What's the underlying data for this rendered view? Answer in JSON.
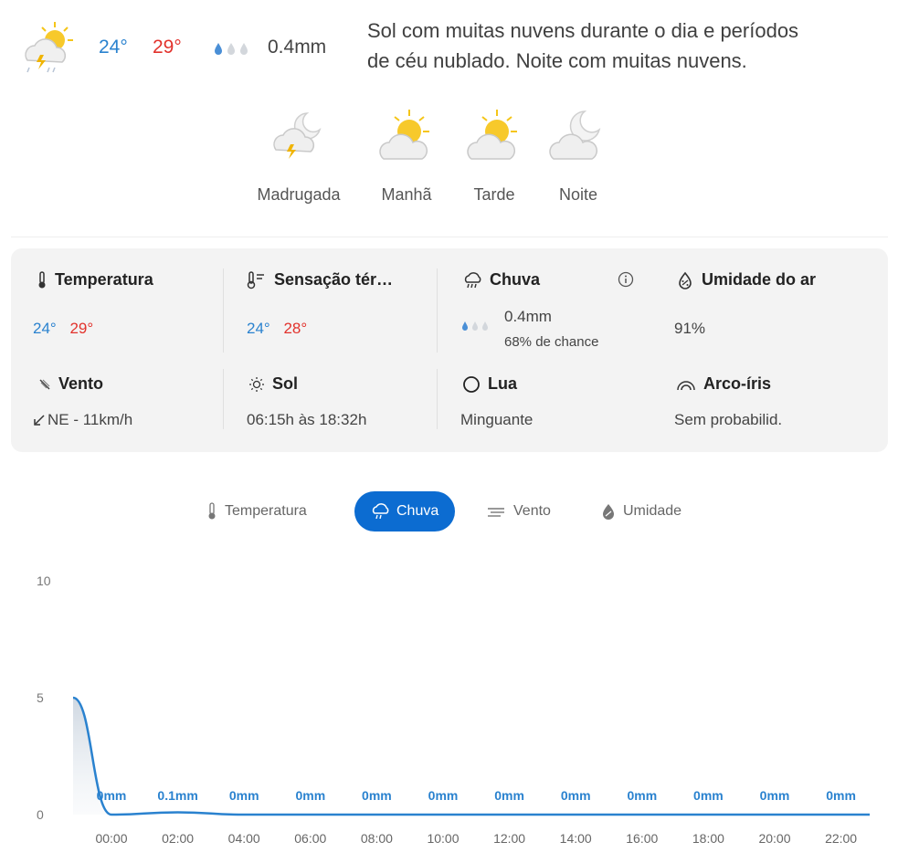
{
  "header": {
    "temp_min": "24°",
    "temp_max": "29°",
    "rain": "0.4mm",
    "description_line1": "Sol com muitas nuvens durante o dia e períodos",
    "description_line2": "de céu nublado. Noite com muitas nuvens."
  },
  "periods": [
    {
      "label": "Madrugada",
      "icon": "night-storm-icon"
    },
    {
      "label": "Manhã",
      "icon": "sun-cloud-icon"
    },
    {
      "label": "Tarde",
      "icon": "sun-cloud-icon"
    },
    {
      "label": "Noite",
      "icon": "moon-cloud-icon"
    }
  ],
  "details": {
    "temperatura": {
      "title": "Temperatura",
      "min": "24°",
      "max": "29°"
    },
    "sensacao": {
      "title": "Sensação tér…",
      "min": "24°",
      "max": "28°"
    },
    "chuva": {
      "title": "Chuva",
      "amount": "0.4mm",
      "chance": "68% de chance"
    },
    "umidade": {
      "title": "Umidade do ar",
      "value": "91%"
    },
    "vento": {
      "title": "Vento",
      "value": "NE - 11km/h"
    },
    "sol": {
      "title": "Sol",
      "value": "06:15h às 18:32h"
    },
    "lua": {
      "title": "Lua",
      "value": "Minguante"
    },
    "arco": {
      "title": "Arco-íris",
      "value": "Sem probabilid."
    }
  },
  "tabs": {
    "temperatura": "Temperatura",
    "chuva": "Chuva",
    "vento": "Vento",
    "umidade": "Umidade"
  },
  "colors": {
    "accent": "#0c6cd1",
    "min": "#2a82cf",
    "max": "#e2322c"
  },
  "chart_data": {
    "type": "area",
    "y_ticks": [
      "10",
      "5",
      "0"
    ],
    "ylim": [
      0,
      10
    ],
    "x": [
      "00:00",
      "02:00",
      "04:00",
      "06:00",
      "08:00",
      "10:00",
      "12:00",
      "14:00",
      "16:00",
      "18:00",
      "20:00",
      "22:00"
    ],
    "series": [
      {
        "values": [
          0,
          0.1,
          0,
          0,
          0,
          0,
          0,
          0,
          0,
          0,
          0,
          0
        ]
      }
    ],
    "leading_value": 5,
    "data_labels": [
      "0mm",
      "0.1mm",
      "0mm",
      "0mm",
      "0mm",
      "0mm",
      "0mm",
      "0mm",
      "0mm",
      "0mm",
      "0mm",
      "0mm"
    ]
  }
}
